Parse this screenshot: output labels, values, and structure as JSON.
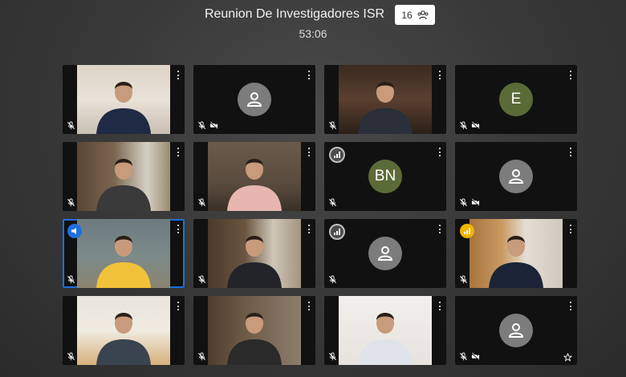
{
  "meeting": {
    "title": "Reunion De Investigadores ISR",
    "participant_count": "16",
    "timer": "53:06"
  },
  "tiles": [
    {
      "kind": "video",
      "scene": "office",
      "mic_muted": true,
      "cam_off": false
    },
    {
      "kind": "avatar",
      "mic_muted": true,
      "cam_off": true
    },
    {
      "kind": "video",
      "scene": "dark",
      "mic_muted": true,
      "cam_off": false
    },
    {
      "kind": "initials",
      "initials": "E",
      "mic_muted": true,
      "cam_off": true
    },
    {
      "kind": "video",
      "scene": "bookshelf",
      "mic_muted": true,
      "cam_off": false
    },
    {
      "kind": "video",
      "scene": "woman",
      "mic_muted": true,
      "cam_off": false
    },
    {
      "kind": "initials",
      "initials": "BN",
      "mic_muted": true,
      "cam_off": false,
      "badge": "signal"
    },
    {
      "kind": "avatar",
      "mic_muted": false,
      "cam_off": true
    },
    {
      "kind": "video",
      "scene": "yellow",
      "mic_muted": true,
      "cam_off": false,
      "badge": "speaker",
      "active": true
    },
    {
      "kind": "video",
      "scene": "library",
      "mic_muted": true,
      "cam_off": false
    },
    {
      "kind": "avatar",
      "mic_muted": true,
      "cam_off": false,
      "badge": "signal"
    },
    {
      "kind": "video",
      "scene": "shelves",
      "mic_muted": true,
      "cam_off": false,
      "badge": "gold"
    },
    {
      "kind": "video",
      "scene": "window",
      "mic_muted": true,
      "cam_off": false
    },
    {
      "kind": "video",
      "scene": "library2",
      "mic_muted": true,
      "cam_off": false
    },
    {
      "kind": "video",
      "scene": "white",
      "mic_muted": false,
      "cam_off": false
    },
    {
      "kind": "avatar",
      "mic_muted": true,
      "cam_off": true,
      "star": true
    }
  ]
}
